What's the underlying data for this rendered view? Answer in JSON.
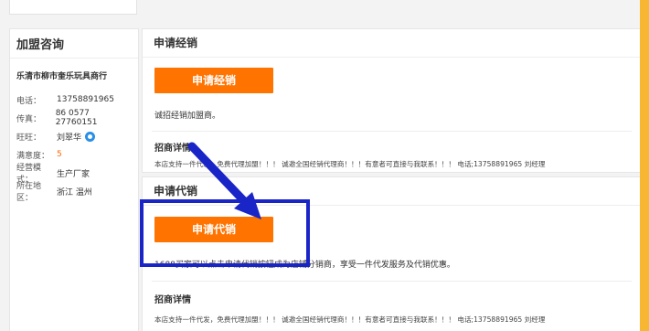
{
  "sidebar": {
    "title": "加盟咨询",
    "company": "乐清市柳市奎乐玩具商行",
    "rows": [
      {
        "label": "电话：",
        "value": "13758891965"
      },
      {
        "label": "传真：",
        "value": "86 0577 27760151"
      },
      {
        "label": "旺旺：",
        "value": "刘翠华"
      },
      {
        "label": "满意度：",
        "value": "5"
      },
      {
        "label": "经营模式：",
        "value": "生产厂家"
      },
      {
        "label": "所在地区：",
        "value": "浙江 温州"
      }
    ]
  },
  "distribution": {
    "title": "申请经销",
    "button": "申请经销",
    "desc": "诚招经销加盟商。",
    "details_title": "招商详情",
    "details_text": "本店支持一件代发，免费代理加盟！！！ 诚邀全国经销代理商！！！有意者可直接与我联系！！！ 电话;13758891965 刘经理"
  },
  "agency": {
    "title": "申请代销",
    "button": "申请代销",
    "desc": "1688买家可以点击申请代销按钮成为店铺分销商，享受一件代发服务及代销优惠。",
    "details_title": "招商详情",
    "details_text": "本店支持一件代发，免费代理加盟！！！ 诚邀全国经销代理商！！！有意者可直接与我联系！！！ 电话;13758891965 刘经理"
  },
  "colors": {
    "accent_orange": "#ff7300",
    "annotation_blue": "#1a25c8",
    "page_border": "#f7b733"
  },
  "icons": {
    "wangwang": "wangwang-chat-icon"
  }
}
